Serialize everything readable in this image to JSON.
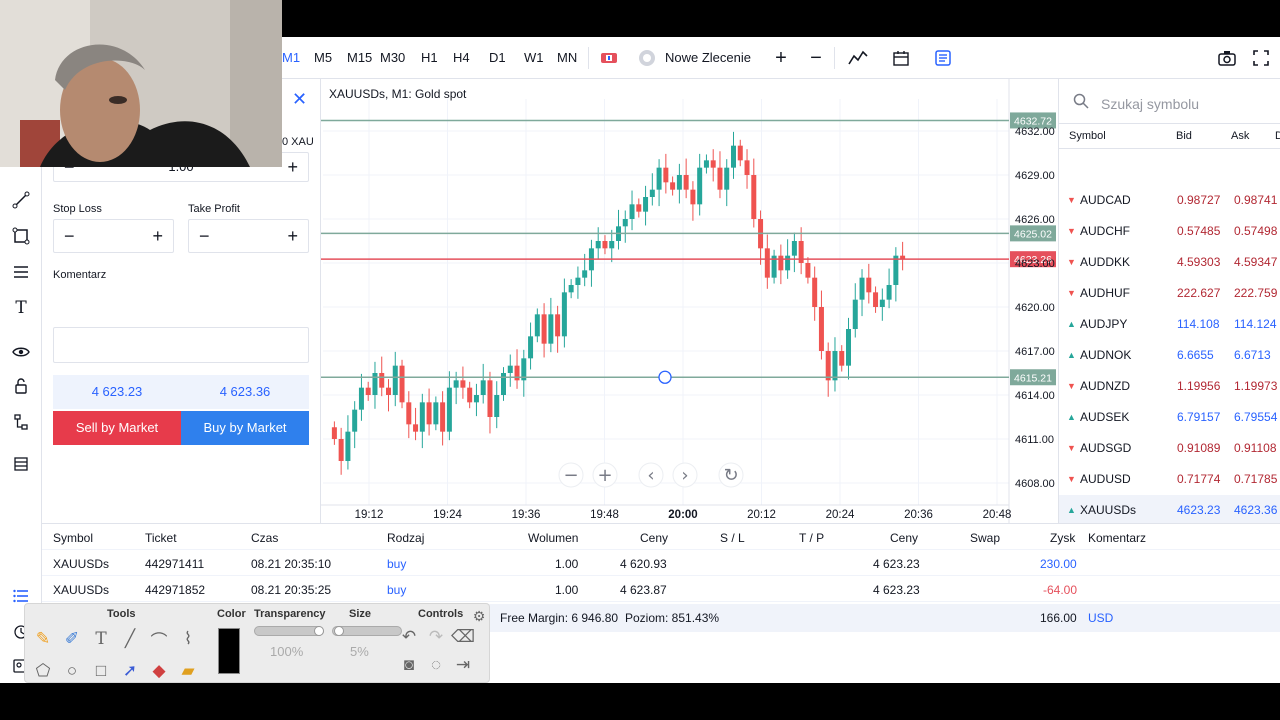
{
  "toolbar": {
    "timeframes": [
      "M1",
      "M5",
      "M15",
      "M30",
      "H1",
      "H4",
      "D1",
      "W1",
      "MN"
    ],
    "new_order_label": "Nowe Zlecenie"
  },
  "order_panel": {
    "volume_unit_fragment": "0 XAU",
    "volume_value": "1.00",
    "stop_loss_label": "Stop Loss",
    "take_profit_label": "Take Profit",
    "comment_label": "Komentarz",
    "sell_price": "4 623.23",
    "buy_price": "4 623.36",
    "sell_button": "Sell by Market",
    "buy_button": "Buy by Market"
  },
  "chart": {
    "title": "XAUUSDs, M1: Gold spot",
    "hlines": [
      {
        "price": 4632.72,
        "label": "4632.72",
        "color": "#7fa99b"
      },
      {
        "price": 4625.02,
        "label": "4625.02",
        "color": "#7fa99b"
      },
      {
        "price": 4623.26,
        "label": "4623.26",
        "color": "#e5505c"
      },
      {
        "price": 4615.21,
        "label": "4615.21",
        "color": "#7fa99b"
      }
    ],
    "controls": [
      "minus-icon",
      "plus-icon",
      "chevron-left-icon",
      "chevron-right-icon",
      "reset-icon"
    ]
  },
  "chart_data": {
    "type": "candlestick",
    "title": "XAUUSDs, M1: Gold spot",
    "y_ticks": [
      "4632.00",
      "4629.00",
      "4626.00",
      "4623.00",
      "4620.00",
      "4617.00",
      "4614.00",
      "4611.00",
      "4608.00"
    ],
    "y_tick_values": [
      4632,
      4629,
      4626,
      4623,
      4620,
      4617,
      4614,
      4611,
      4608
    ],
    "x_ticks": [
      "19:12",
      "19:24",
      "19:36",
      "19:48",
      "20:00",
      "20:12",
      "20:24",
      "20:36",
      "20:48"
    ],
    "ylim": [
      4606.5,
      4633.5
    ],
    "candles_close_path": [
      4611.0,
      4609.5,
      4611.5,
      4613.0,
      4614.5,
      4614.0,
      4615.5,
      4614.5,
      4614.0,
      4616.0,
      4613.5,
      4612.0,
      4611.5,
      4613.5,
      4612.0,
      4613.5,
      4611.5,
      4614.5,
      4615.0,
      4614.5,
      4613.5,
      4614.0,
      4615.0,
      4612.5,
      4614.0,
      4615.5,
      4616.0,
      4615.0,
      4616.5,
      4618.0,
      4619.5,
      4617.5,
      4619.5,
      4618.0,
      4621.0,
      4621.5,
      4622.0,
      4622.5,
      4624.0,
      4624.5,
      4624.0,
      4624.5,
      4625.5,
      4626.0,
      4627.0,
      4626.5,
      4627.5,
      4628.0,
      4629.5,
      4628.5,
      4628.0,
      4629.0,
      4628.0,
      4627.0,
      4629.5,
      4630.0,
      4629.5,
      4628.0,
      4629.5,
      4631.0,
      4630.0,
      4629.0,
      4626.0,
      4624.0,
      4622.0,
      4623.5,
      4622.5,
      4623.5,
      4624.5,
      4623.0,
      4622.0,
      4620.0,
      4617.0,
      4615.0,
      4617.0,
      4616.0,
      4618.5,
      4620.5,
      4622.0,
      4621.0,
      4620.0,
      4620.5,
      4621.5,
      4623.5,
      4623.26
    ]
  },
  "symbols": {
    "search_placeholder": "Szukaj symbolu",
    "headers": {
      "symbol": "Symbol",
      "bid": "Bid",
      "ask": "Ask",
      "extra": "D"
    },
    "rows": [
      {
        "symbol": "AUDCAD",
        "bid": "0.98727",
        "ask": "0.98741",
        "dir": "down"
      },
      {
        "symbol": "AUDCHF",
        "bid": "0.57485",
        "ask": "0.57498",
        "dir": "down"
      },
      {
        "symbol": "AUDDKK",
        "bid": "4.59303",
        "ask": "4.59347",
        "dir": "down"
      },
      {
        "symbol": "AUDHUF",
        "bid": "222.627",
        "ask": "222.759",
        "dir": "down"
      },
      {
        "symbol": "AUDJPY",
        "bid": "114.108",
        "ask": "114.124",
        "dir": "up"
      },
      {
        "symbol": "AUDNOK",
        "bid": "6.6655",
        "ask": "6.6713",
        "dir": "up"
      },
      {
        "symbol": "AUDNZD",
        "bid": "1.19956",
        "ask": "1.19973",
        "dir": "down"
      },
      {
        "symbol": "AUDSEK",
        "bid": "6.79157",
        "ask": "6.79554",
        "dir": "up"
      },
      {
        "symbol": "AUDSGD",
        "bid": "0.91089",
        "ask": "0.91108",
        "dir": "down"
      },
      {
        "symbol": "AUDUSD",
        "bid": "0.71774",
        "ask": "0.71785",
        "dir": "down"
      },
      {
        "symbol": "XAUUSDs",
        "bid": "4623.23",
        "ask": "4623.36",
        "dir": "up"
      }
    ]
  },
  "trades": {
    "headers": {
      "symbol": "Symbol",
      "ticket": "Ticket",
      "time": "Czas",
      "type": "Rodzaj",
      "volume": "Wolumen",
      "price": "Ceny",
      "sl": "S / L",
      "tp": "T / P",
      "price2": "Ceny",
      "swap": "Swap",
      "profit": "Zysk",
      "comment": "Komentarz"
    },
    "rows": [
      {
        "symbol": "XAUUSDs",
        "ticket": "442971411",
        "time": "08.21 20:35:10",
        "type": "buy",
        "volume": "1.00",
        "price": "4 620.93",
        "price2": "4 623.23",
        "profit": "230.00"
      },
      {
        "symbol": "XAUUSDs",
        "ticket": "442971852",
        "time": "08.21 20:35:25",
        "type": "buy",
        "volume": "1.00",
        "price": "4 623.87",
        "price2": "4 623.23",
        "profit": "-64.00"
      }
    ],
    "footer": {
      "free_margin": "Free Margin: 6 946.80",
      "level": "Poziom: 851.43%",
      "total": "166.00",
      "currency": "USD"
    }
  },
  "palette": {
    "tools_label": "Tools",
    "color_label": "Color",
    "transparency_label": "Transparency",
    "size_label": "Size",
    "controls_label": "Controls",
    "transparency_value": "100%",
    "size_value": "5%",
    "selected_color": "#000000"
  },
  "colors": {
    "up": "#26a69a",
    "down": "#ef5350",
    "accent": "#2962ff",
    "sell": "#e73b4b",
    "buy": "#2f80ed"
  }
}
